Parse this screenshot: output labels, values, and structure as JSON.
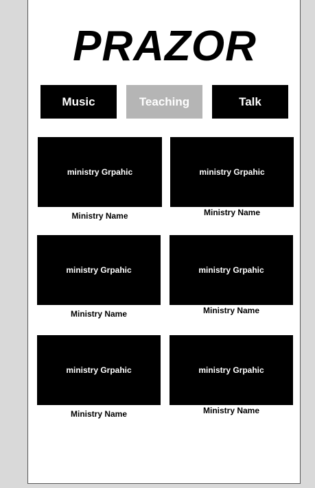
{
  "app": {
    "logo": "PRAZOR"
  },
  "tabs": [
    {
      "label": "Music",
      "active": false
    },
    {
      "label": "Teaching",
      "active": true
    },
    {
      "label": "Talk",
      "active": false
    }
  ],
  "ministries": [
    {
      "graphic": "ministry Grpahic",
      "name": "Ministry Name"
    },
    {
      "graphic": "ministry Grpahic",
      "name": "Ministry Name"
    },
    {
      "graphic": "ministry Grpahic",
      "name": "Ministry Name"
    },
    {
      "graphic": "ministry Grpahic",
      "name": "Ministry Name"
    },
    {
      "graphic": "ministry Grpahic",
      "name": "Ministry Name"
    },
    {
      "graphic": "ministry Grpahic",
      "name": "Ministry Name"
    }
  ],
  "colors": {
    "tab_active": "#b5b5b5",
    "tab_default": "#000000",
    "card_background": "#000000"
  }
}
